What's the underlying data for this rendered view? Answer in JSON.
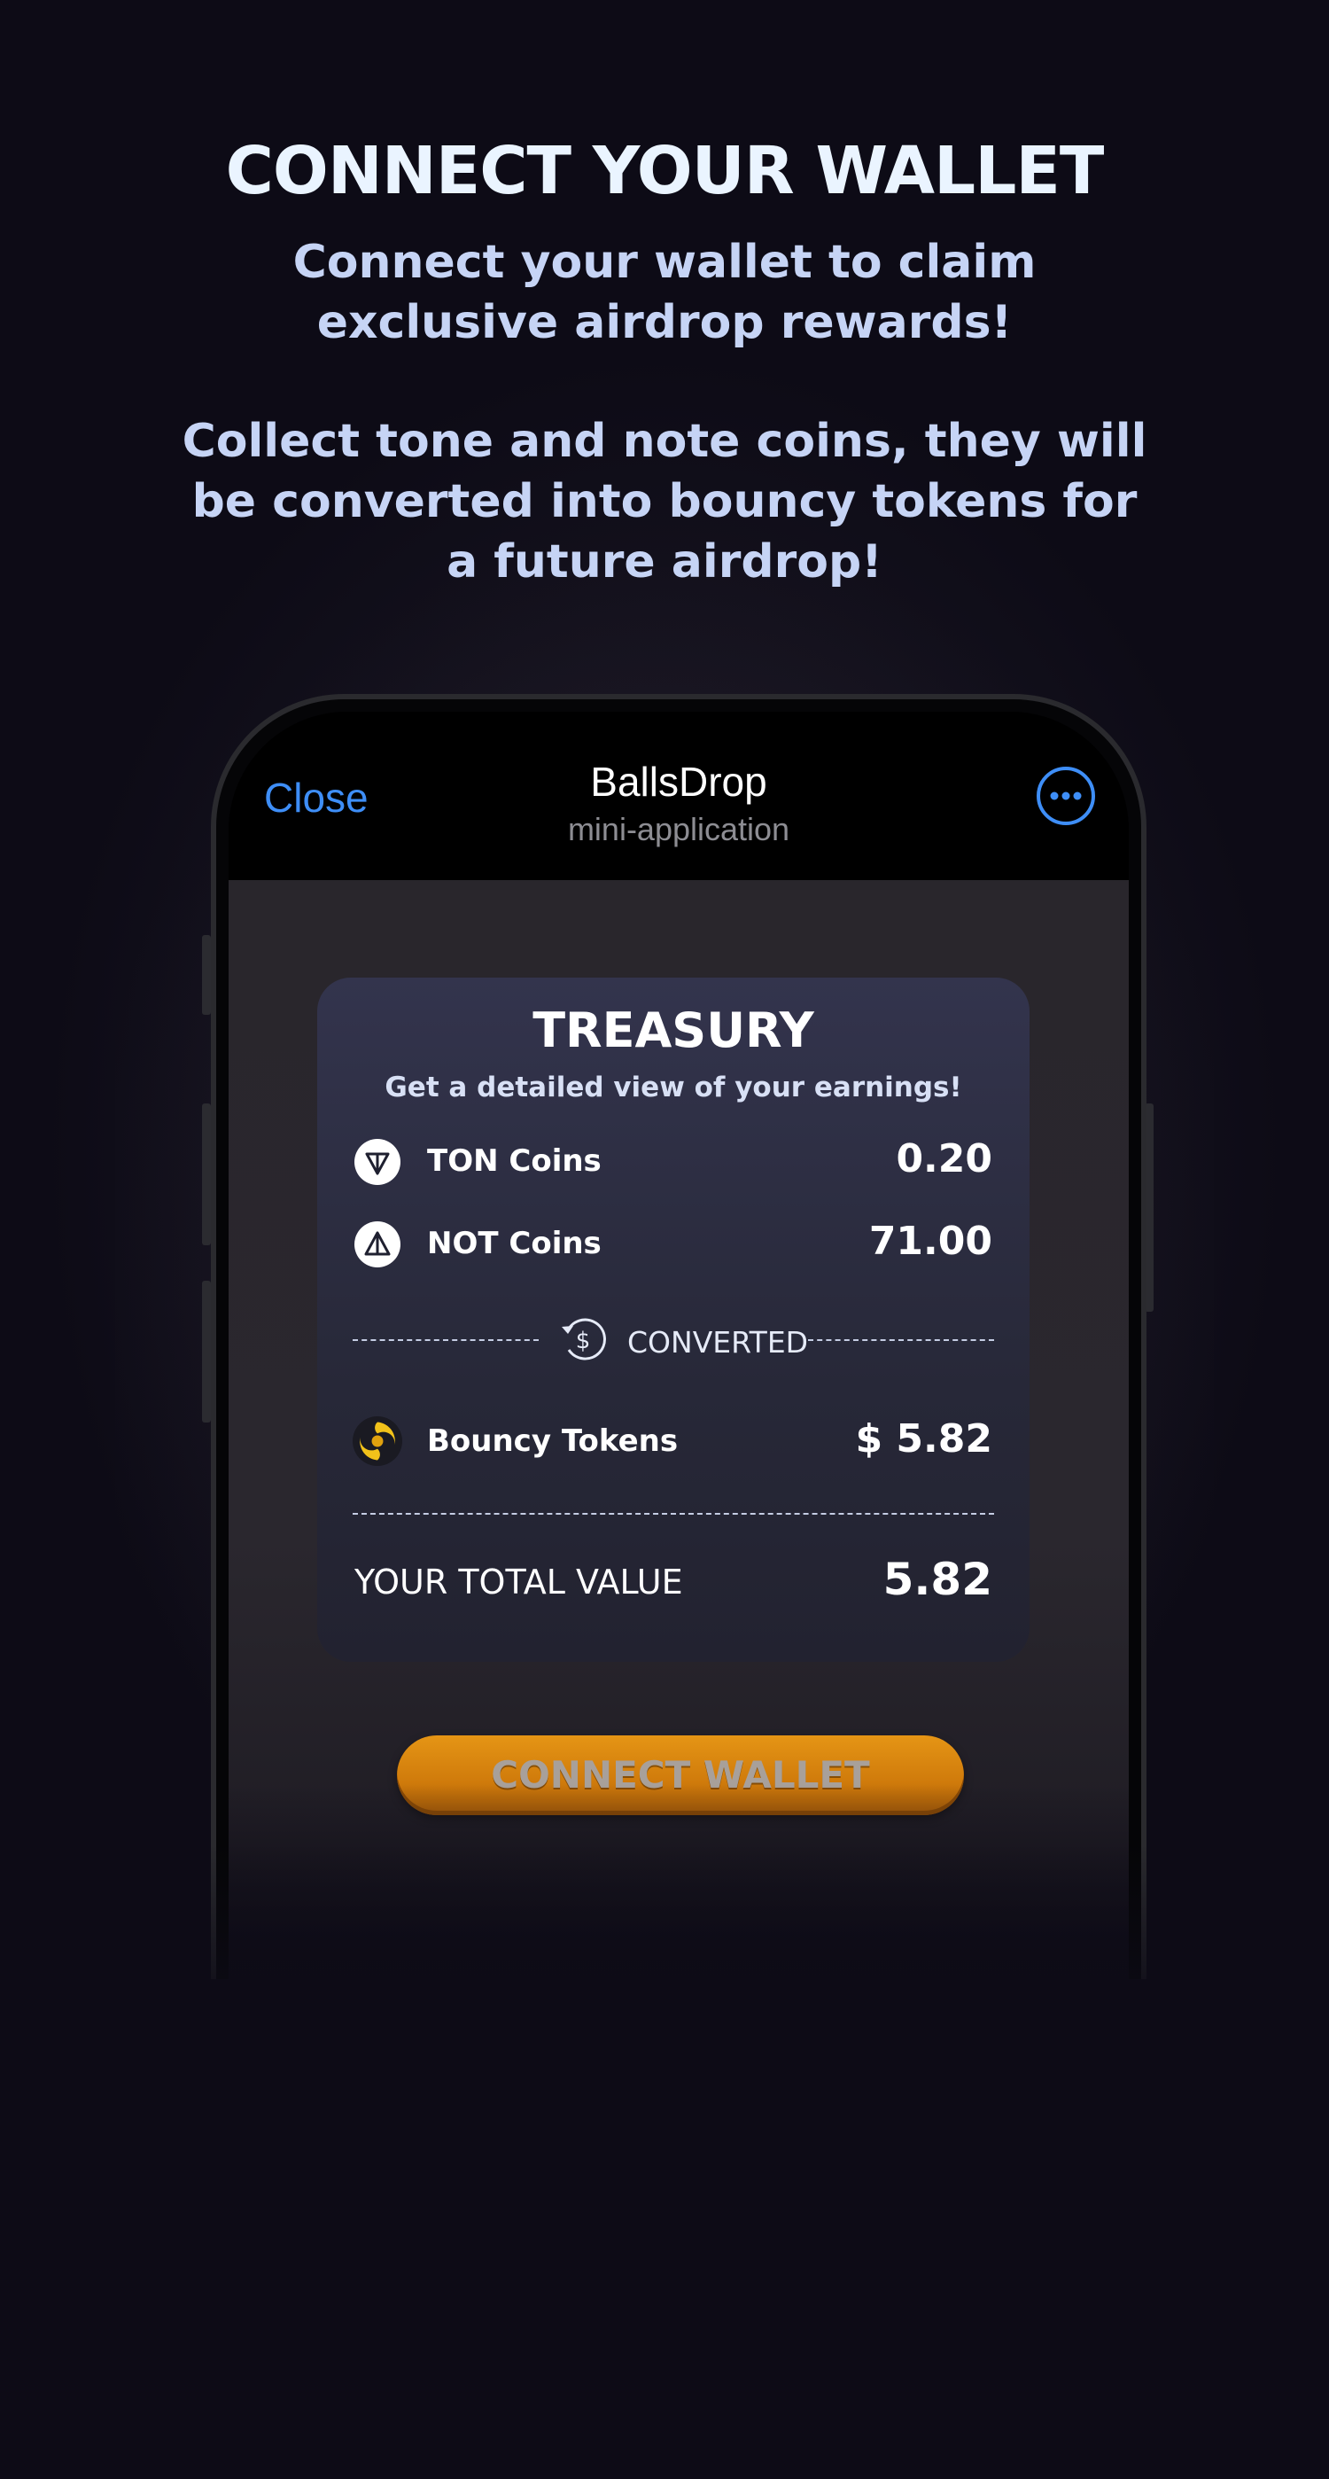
{
  "intro": {
    "headline": "CONNECT YOUR WALLET",
    "line1": "Connect your wallet to claim exclusive airdrop rewards!",
    "line2": "Collect tone and note coins, they will be converted into bouncy tokens for a future airdrop!"
  },
  "telegram_header": {
    "close_label": "Close",
    "app_name": "BallsDrop",
    "app_subtitle": "mini-application",
    "more_icon": "ellipsis-circle-icon"
  },
  "treasury": {
    "title": "TREASURY",
    "subtitle": "Get a detailed view of your earnings!",
    "ton": {
      "label": "TON Coins",
      "value": "0.20",
      "icon": "ton-icon"
    },
    "not": {
      "label": "NOT Coins",
      "value": "71.00",
      "icon": "not-icon"
    },
    "converted_label": "CONVERTED",
    "bouncy": {
      "label": "Bouncy Tokens",
      "value": "$ 5.82",
      "icon": "bouncy-token-icon"
    },
    "total_label": "YOUR TOTAL VALUE",
    "total_value": "5.82"
  },
  "cta": {
    "label": "CONNECT WALLET"
  },
  "colors": {
    "accent_blue": "#3e8ef7",
    "button_orange": "#e59515",
    "background": "#0d0b16"
  }
}
